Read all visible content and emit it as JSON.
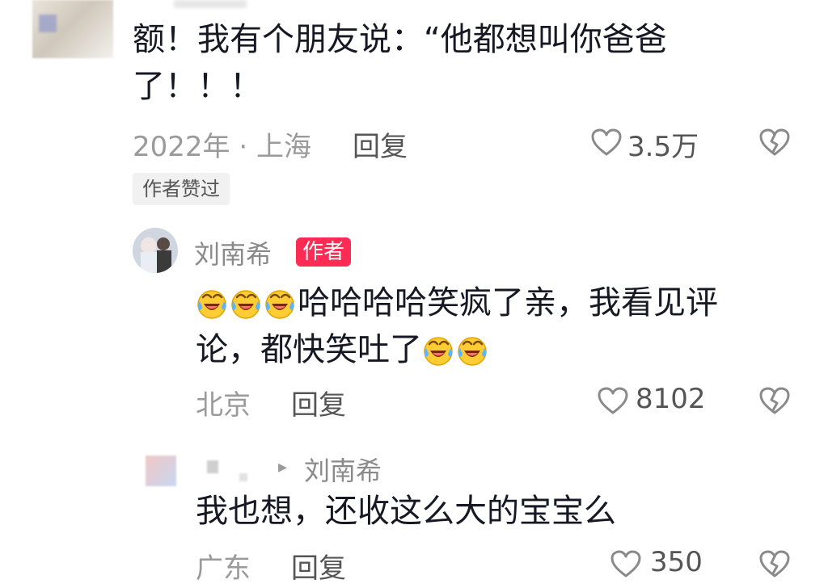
{
  "comment1": {
    "text_line1": "额！我有个朋友说：“他都想叫你爸爸",
    "text_line2": "了！！！",
    "meta": "2022年 · 上海",
    "reply_label": "回复",
    "likes": "3.5万",
    "author_liked_badge": "作者赞过"
  },
  "comment2": {
    "username": "刘南希",
    "author_badge": "作者",
    "text_line1": "哈哈哈哈笑疯了亲，我看见评",
    "text_line2": "论，都快笑吐了",
    "location": "北京",
    "reply_label": "回复",
    "likes": "8102"
  },
  "comment3": {
    "reply_to": "刘南希",
    "text": "我也想，还收这么大的宝宝么",
    "location": "广东",
    "reply_label": "回复",
    "likes": "350"
  },
  "icons": {
    "like": "heart-outline-icon",
    "dislike": "broken-heart-icon",
    "emoji": "laughing-tears-emoji"
  },
  "colors": {
    "author_badge": "#fe2c55",
    "meta_text": "#9a9a9a",
    "body_text": "#161823"
  }
}
